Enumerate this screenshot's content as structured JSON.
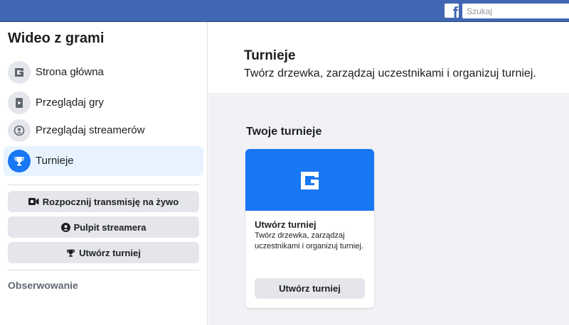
{
  "topbar": {
    "logo_letter": "f",
    "search_placeholder": "Szukaj",
    "color": "#4267b2"
  },
  "sidebar": {
    "title": "Wideo z grami",
    "items": [
      {
        "label": "Strona główna",
        "icon": "gaming-home-icon",
        "active": false
      },
      {
        "label": "Przeglądaj gry",
        "icon": "browse-games-icon",
        "active": false
      },
      {
        "label": "Przeglądaj streamerów",
        "icon": "streamers-icon",
        "active": false
      },
      {
        "label": "Turnieje",
        "icon": "trophy-icon",
        "active": true
      }
    ],
    "buttons": [
      {
        "label": "Rozpocznij transmisję na żywo",
        "icon": "live-camera-icon"
      },
      {
        "label": "Pulpit streamera",
        "icon": "streamer-dashboard-icon"
      },
      {
        "label": "Utwórz turniej",
        "icon": "trophy-icon"
      }
    ],
    "following_title": "Obserwowanie"
  },
  "main": {
    "title": "Turnieje",
    "subtitle": "Twórz drzewka, zarządzaj uczestnikami i organizuj turniej.",
    "section_title": "Twoje turnieje",
    "card": {
      "icon": "gaming-logo-icon",
      "title": "Utwórz turniej",
      "description": "Twórz drzewka, zarządzaj uczestnikami i organizuj turniej.",
      "button_label": "Utwórz turniej"
    }
  },
  "colors": {
    "accent": "#1877f2",
    "active_bg": "#e7f3ff",
    "button_bg": "#e4e6eb",
    "content_bg": "#f0f2f5"
  }
}
